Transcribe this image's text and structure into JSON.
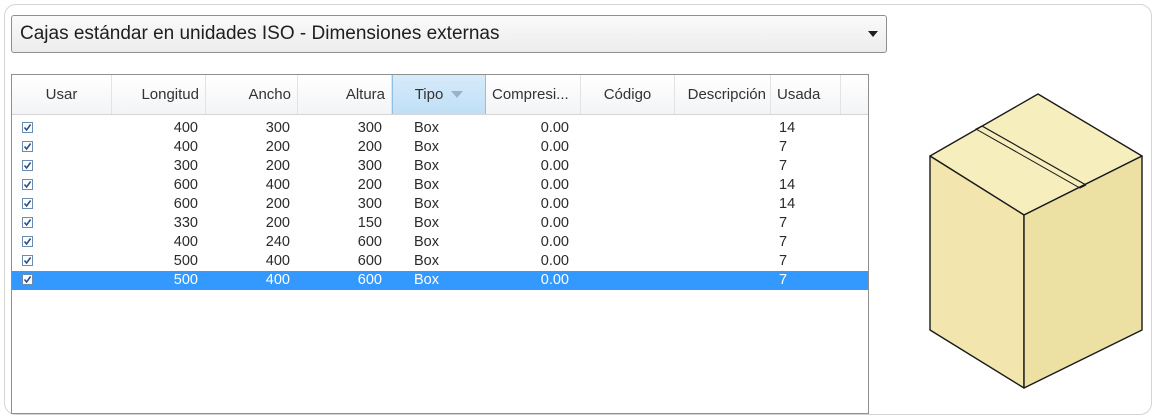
{
  "dropdown": {
    "selected": "Cajas estándar en unidades ISO - Dimensiones externas",
    "arrow_icon": "dropdown-arrow-icon"
  },
  "grid": {
    "columns": [
      {
        "key": "usar",
        "label": "Usar"
      },
      {
        "key": "longitud",
        "label": "Longitud"
      },
      {
        "key": "ancho",
        "label": "Ancho"
      },
      {
        "key": "altura",
        "label": "Altura"
      },
      {
        "key": "tipo",
        "label": "Tipo"
      },
      {
        "key": "compresion",
        "label": "Compresi..."
      },
      {
        "key": "codigo",
        "label": "Código"
      },
      {
        "key": "descripcion",
        "label": "Descripción"
      },
      {
        "key": "usada",
        "label": "Usada"
      }
    ],
    "sorted_column": "tipo",
    "sort_direction": "descending",
    "rows": [
      {
        "usar": true,
        "longitud": "400",
        "ancho": "300",
        "altura": "300",
        "tipo": "Box",
        "compresion": "0.00",
        "codigo": "",
        "descripcion": "",
        "usada": "14"
      },
      {
        "usar": true,
        "longitud": "400",
        "ancho": "200",
        "altura": "200",
        "tipo": "Box",
        "compresion": "0.00",
        "codigo": "",
        "descripcion": "",
        "usada": "7"
      },
      {
        "usar": true,
        "longitud": "300",
        "ancho": "200",
        "altura": "300",
        "tipo": "Box",
        "compresion": "0.00",
        "codigo": "",
        "descripcion": "",
        "usada": "7"
      },
      {
        "usar": true,
        "longitud": "600",
        "ancho": "400",
        "altura": "200",
        "tipo": "Box",
        "compresion": "0.00",
        "codigo": "",
        "descripcion": "",
        "usada": "14"
      },
      {
        "usar": true,
        "longitud": "600",
        "ancho": "200",
        "altura": "300",
        "tipo": "Box",
        "compresion": "0.00",
        "codigo": "",
        "descripcion": "",
        "usada": "14"
      },
      {
        "usar": true,
        "longitud": "330",
        "ancho": "200",
        "altura": "150",
        "tipo": "Box",
        "compresion": "0.00",
        "codigo": "",
        "descripcion": "",
        "usada": "7"
      },
      {
        "usar": true,
        "longitud": "400",
        "ancho": "240",
        "altura": "600",
        "tipo": "Box",
        "compresion": "0.00",
        "codigo": "",
        "descripcion": "",
        "usada": "7"
      },
      {
        "usar": true,
        "longitud": "500",
        "ancho": "400",
        "altura": "600",
        "tipo": "Box",
        "compresion": "0.00",
        "codigo": "",
        "descripcion": "",
        "usada": "7"
      },
      {
        "usar": true,
        "longitud": "500",
        "ancho": "400",
        "altura": "600",
        "tipo": "Box",
        "compresion": "0.00",
        "codigo": "",
        "descripcion": "",
        "usada": "7"
      }
    ],
    "selected_row": 8
  },
  "preview": {
    "icon": "cardboard-box-icon",
    "colors": {
      "face": "#f2e6ae",
      "top": "#f7eebd",
      "side": "#e9dc9c",
      "stroke": "#1a1a1a"
    }
  },
  "colors": {
    "selection": "#3399ff",
    "sorted_header": "#c9e4f8"
  }
}
